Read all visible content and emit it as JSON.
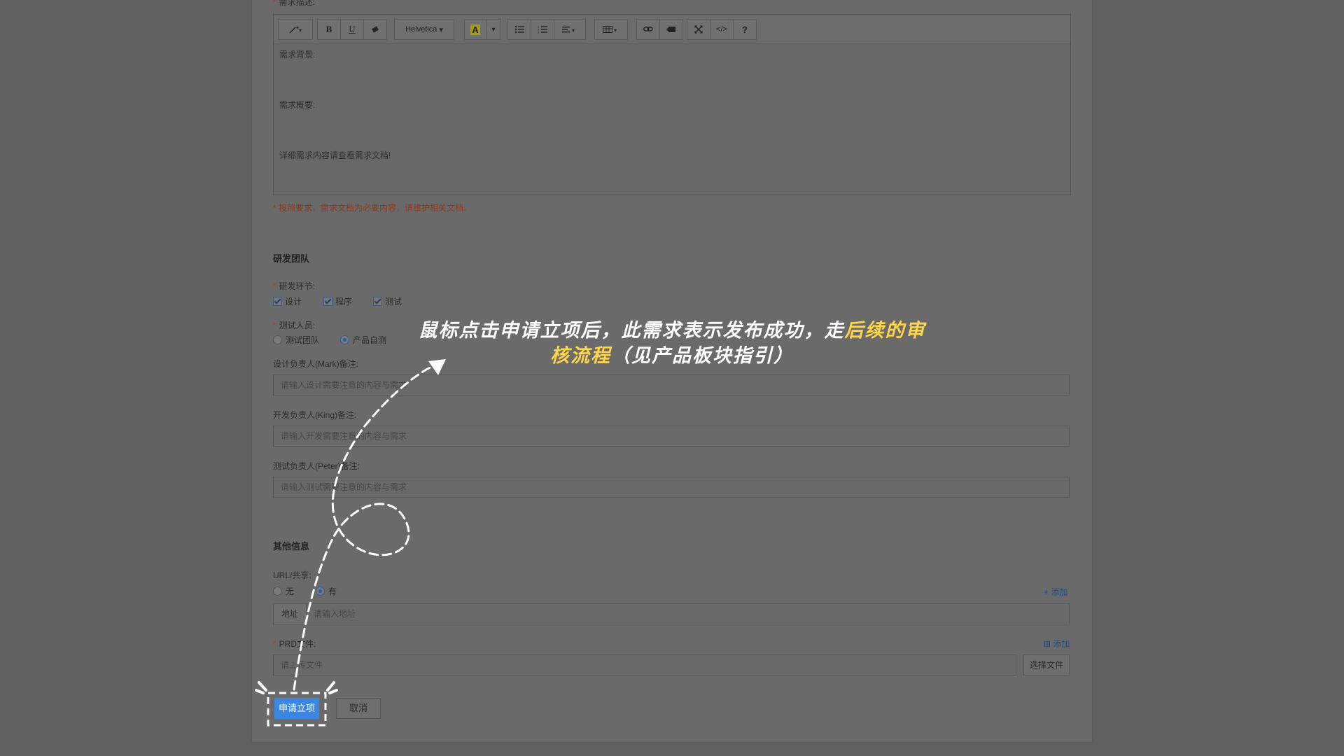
{
  "editor": {
    "required_label": "需求描述:",
    "toolbar": {
      "magic_icon": "magic-wand-icon",
      "bold": "B",
      "underline": "U",
      "eraser_icon": "eraser-icon",
      "font": "Helvetica",
      "color_letter": "A",
      "caret": "▾",
      "ul_icon": "unordered-list-icon",
      "ol_icon": "ordered-list-icon",
      "align_icon": "align-icon",
      "table_icon": "table-icon",
      "link_icon": "link-icon",
      "video_icon": "video-icon",
      "fullscreen_icon": "fullscreen-icon",
      "code": "</>",
      "help": "?"
    },
    "lines": [
      "需求背景:",
      "需求概要:",
      "详细需求内容请查看需求文档!"
    ]
  },
  "hint": "* 按照要求，需求文档为必要内容，请维护相关文档。",
  "team": {
    "title": "研发团队",
    "stage_label": "研发环节:",
    "stages": [
      {
        "label": "设计",
        "checked": true
      },
      {
        "label": "程序",
        "checked": true
      },
      {
        "label": "测试",
        "checked": true
      }
    ],
    "tester_label": "测试人员:",
    "tester_options": [
      {
        "label": "测试团队",
        "selected": false
      },
      {
        "label": "产品自测",
        "selected": true
      }
    ],
    "design_label": "设计负责人(Mark)备注:",
    "design_placeholder": "请输入设计需要注意的内容与需求",
    "dev_label": "开发负责人(King)备注:",
    "dev_placeholder": "请输入开发需要注意的内容与需求",
    "test_label": "测试负责人(Peter)备注:",
    "test_placeholder": "请输入测试需要注意的内容与需求"
  },
  "other": {
    "title": "其他信息",
    "url_label": "URL/共享:",
    "url_options": [
      {
        "label": "无",
        "selected": false
      },
      {
        "label": "有",
        "selected": true
      }
    ],
    "add_link": "+ 添加",
    "addr_label": "地址",
    "addr_placeholder": "请输入地址",
    "prd_label": "PRD文件:",
    "prd_add": "添加",
    "prd_placeholder": "请上传文件",
    "choose_file": "选择文件"
  },
  "actions": {
    "submit": "申请立项",
    "cancel": "取消"
  },
  "annotation": {
    "line1_a": "鼠标点击申请立项后，此需求表示发布成功，走",
    "line1_b": "后续的审",
    "line2_a": "核流程",
    "line2_b": "（见产品板块指引）"
  },
  "colors": {
    "primary": "#3a86e0",
    "highlight": "#ffd54a"
  }
}
